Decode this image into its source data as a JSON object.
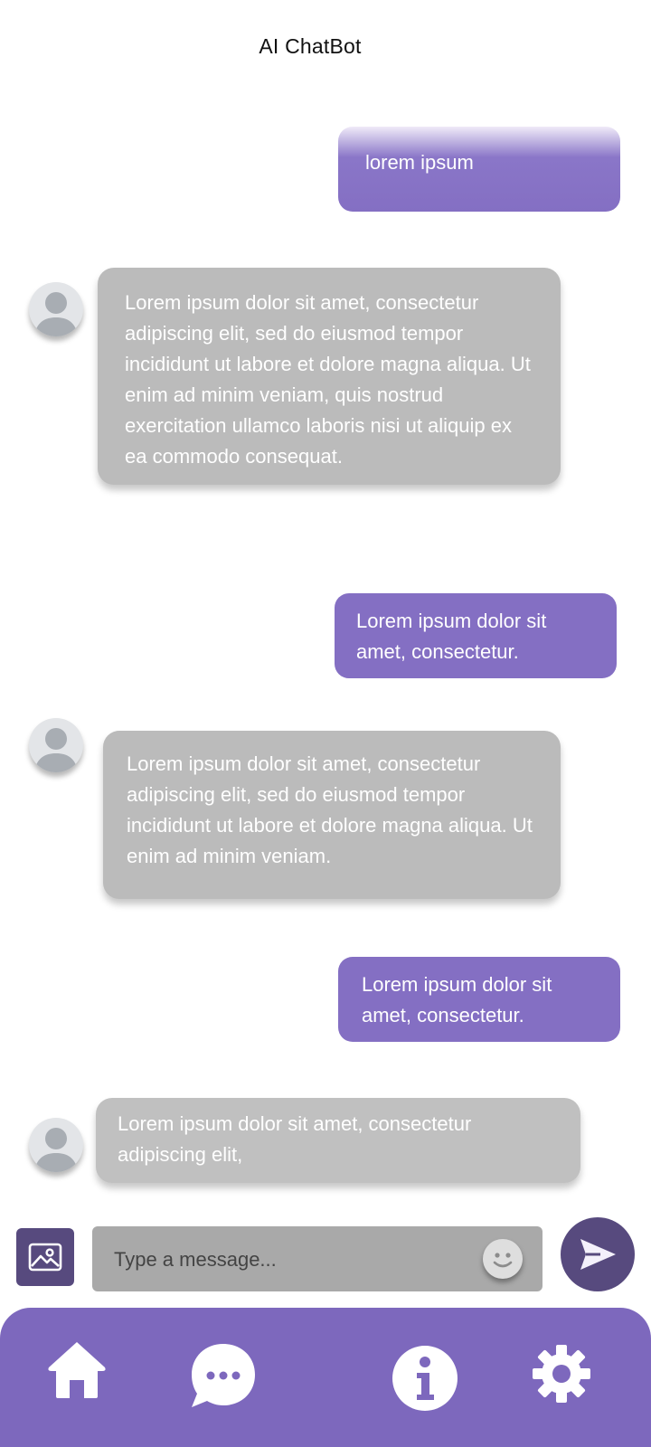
{
  "header": {
    "title": "AI ChatBot"
  },
  "messages": [
    {
      "role": "user",
      "text": "lorem ipsum"
    },
    {
      "role": "bot",
      "text": "Lorem ipsum dolor sit amet, consectetur adipiscing elit, sed do eiusmod tempor incididunt ut labore et dolore magna aliqua. Ut enim ad minim veniam, quis nostrud exercitation ullamco laboris nisi ut aliquip ex ea commodo consequat."
    },
    {
      "role": "user",
      "text": "Lorem ipsum dolor sit amet, consectetur."
    },
    {
      "role": "bot",
      "text": "Lorem ipsum dolor sit amet, consectetur adipiscing elit, sed do eiusmod tempor incididunt ut labore et dolore magna aliqua. Ut enim ad minim veniam."
    },
    {
      "role": "user",
      "text": "Lorem ipsum dolor sit amet, consectetur."
    },
    {
      "role": "bot",
      "text": "Lorem ipsum dolor sit amet, consectetur adipiscing elit,"
    }
  ],
  "composer": {
    "placeholder": "Type a message...",
    "image_icon": "image-icon",
    "emoji_icon": "smiley-icon",
    "send_icon": "send-icon"
  },
  "nav": {
    "items": [
      {
        "icon": "home-icon"
      },
      {
        "icon": "chat-icon"
      },
      {
        "icon": "info-icon"
      },
      {
        "icon": "gear-icon"
      }
    ]
  },
  "colors": {
    "accent": "#846fc3",
    "accent_dark": "#574a7e",
    "nav_bg": "#7d68bd",
    "bot_bubble": "#bbbbbb",
    "input_bg": "#a9a9a9"
  }
}
